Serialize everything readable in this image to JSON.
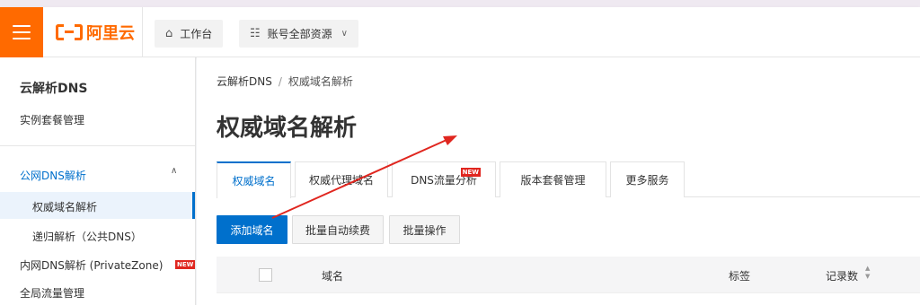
{
  "header": {
    "logo_text": "阿里云",
    "workbench_label": "工作台",
    "resource_label": "账号全部资源"
  },
  "sidebar": {
    "title": "云解析DNS",
    "items": [
      {
        "label": "实例套餐管理"
      },
      {
        "label": "公网DNS解析"
      },
      {
        "label": "权威域名解析"
      },
      {
        "label": "递归解析（公共DNS）"
      },
      {
        "label": "内网DNS解析 (PrivateZone)",
        "badge": "NEW"
      },
      {
        "label": "全局流量管理"
      }
    ]
  },
  "breadcrumb": {
    "root": "云解析DNS",
    "separator": "/",
    "current": "权威域名解析"
  },
  "page": {
    "title": "权威域名解析"
  },
  "tabs": [
    {
      "label": "权威域名",
      "active": true
    },
    {
      "label": "权威代理域名"
    },
    {
      "label": "DNS流量分析",
      "badge": "NEW"
    },
    {
      "label": "版本套餐管理"
    },
    {
      "label": "更多服务"
    }
  ],
  "toolbar": {
    "add_label": "添加域名",
    "renew_label": "批量自动续费",
    "batch_label": "批量操作"
  },
  "table": {
    "columns": [
      "域名",
      "标签",
      "记录数"
    ]
  },
  "colors": {
    "brand": "#ff6a00",
    "accent": "#0070cc",
    "badge": "#e0261f",
    "annotation_arrow": "#e0261f"
  },
  "icons": [
    "menu-icon",
    "home-icon",
    "resource-group-icon",
    "chevron-down-icon",
    "chevron-up-icon",
    "sort-icon"
  ]
}
